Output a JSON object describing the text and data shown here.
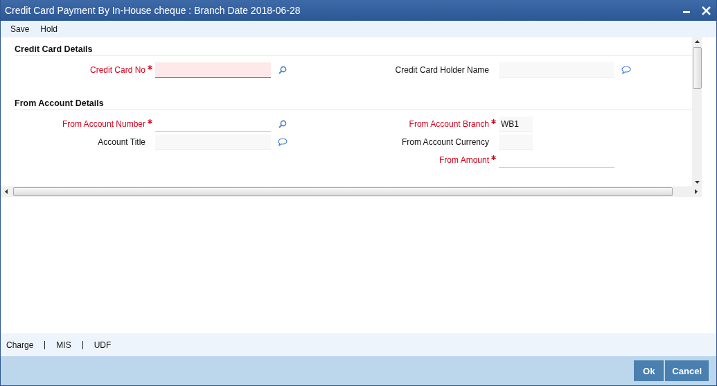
{
  "window": {
    "title": "Credit Card Payment By In-House cheque : Branch Date 2018-06-28"
  },
  "menu": [
    "Save",
    "Hold"
  ],
  "sections": [
    {
      "title": "Credit Card Details",
      "rows": [
        {
          "left": {
            "label": "Credit Card No",
            "required": true,
            "kind": "card"
          },
          "right": {
            "label": "Credit Card Holder Name",
            "required": false,
            "kind": "info"
          }
        }
      ]
    },
    {
      "title": "From Account Details",
      "rows": [
        {
          "left": {
            "label": "From Account Number",
            "required": true,
            "kind": "lookup"
          },
          "right": {
            "label": "From Account Branch",
            "required": true,
            "kind": "code",
            "value": "WB1"
          }
        },
        {
          "left": {
            "label": "Account Title",
            "required": false,
            "kind": "info"
          },
          "right": {
            "label": "From Account Currency",
            "required": false,
            "kind": "code"
          }
        },
        {
          "right": {
            "label": "From Amount",
            "required": true,
            "kind": "amount"
          }
        }
      ]
    }
  ],
  "footer_links": [
    "Charge",
    "MIS",
    "UDF"
  ],
  "buttons": [
    "Ok",
    "Cancel"
  ]
}
